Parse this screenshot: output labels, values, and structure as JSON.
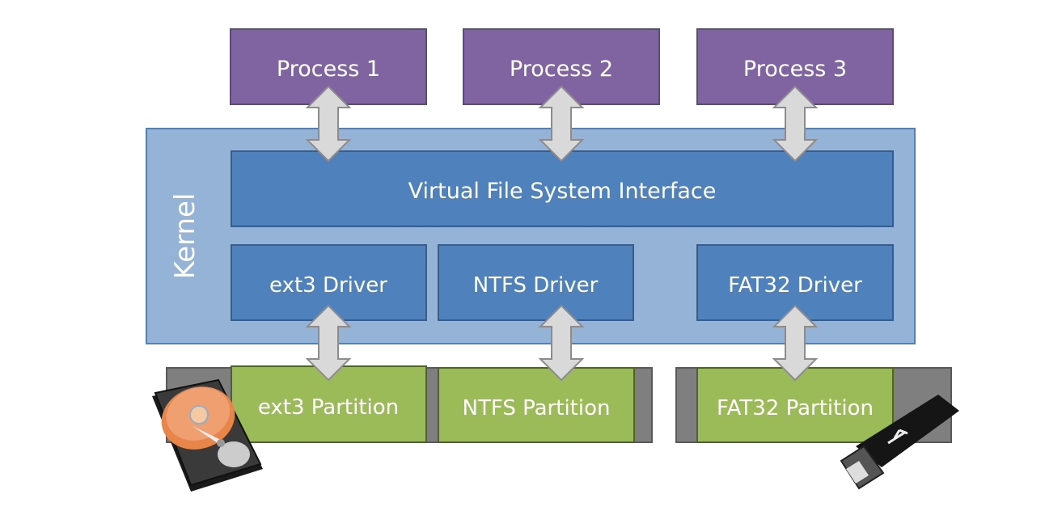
{
  "processes": [
    "Process 1",
    "Process 2",
    "Process 3"
  ],
  "kernel": {
    "label": "Kernel",
    "vfs_label": "Virtual File System Interface",
    "drivers": [
      "ext3 Driver",
      "NTFS Driver",
      "FAT32 Driver"
    ]
  },
  "partitions": [
    "ext3 Partition",
    "NTFS Partition",
    "FAT32 Partition"
  ],
  "icons": [
    "hard-disk-icon",
    "usb-drive-icon",
    "double-arrow-icon"
  ],
  "colors": {
    "process": "#8064a2",
    "kernel": "#95b3d7",
    "vfs_driver": "#4f81bd",
    "partition": "#9bbb59",
    "disk": "#7f7f7f",
    "arrow": "#d9d9d9"
  }
}
